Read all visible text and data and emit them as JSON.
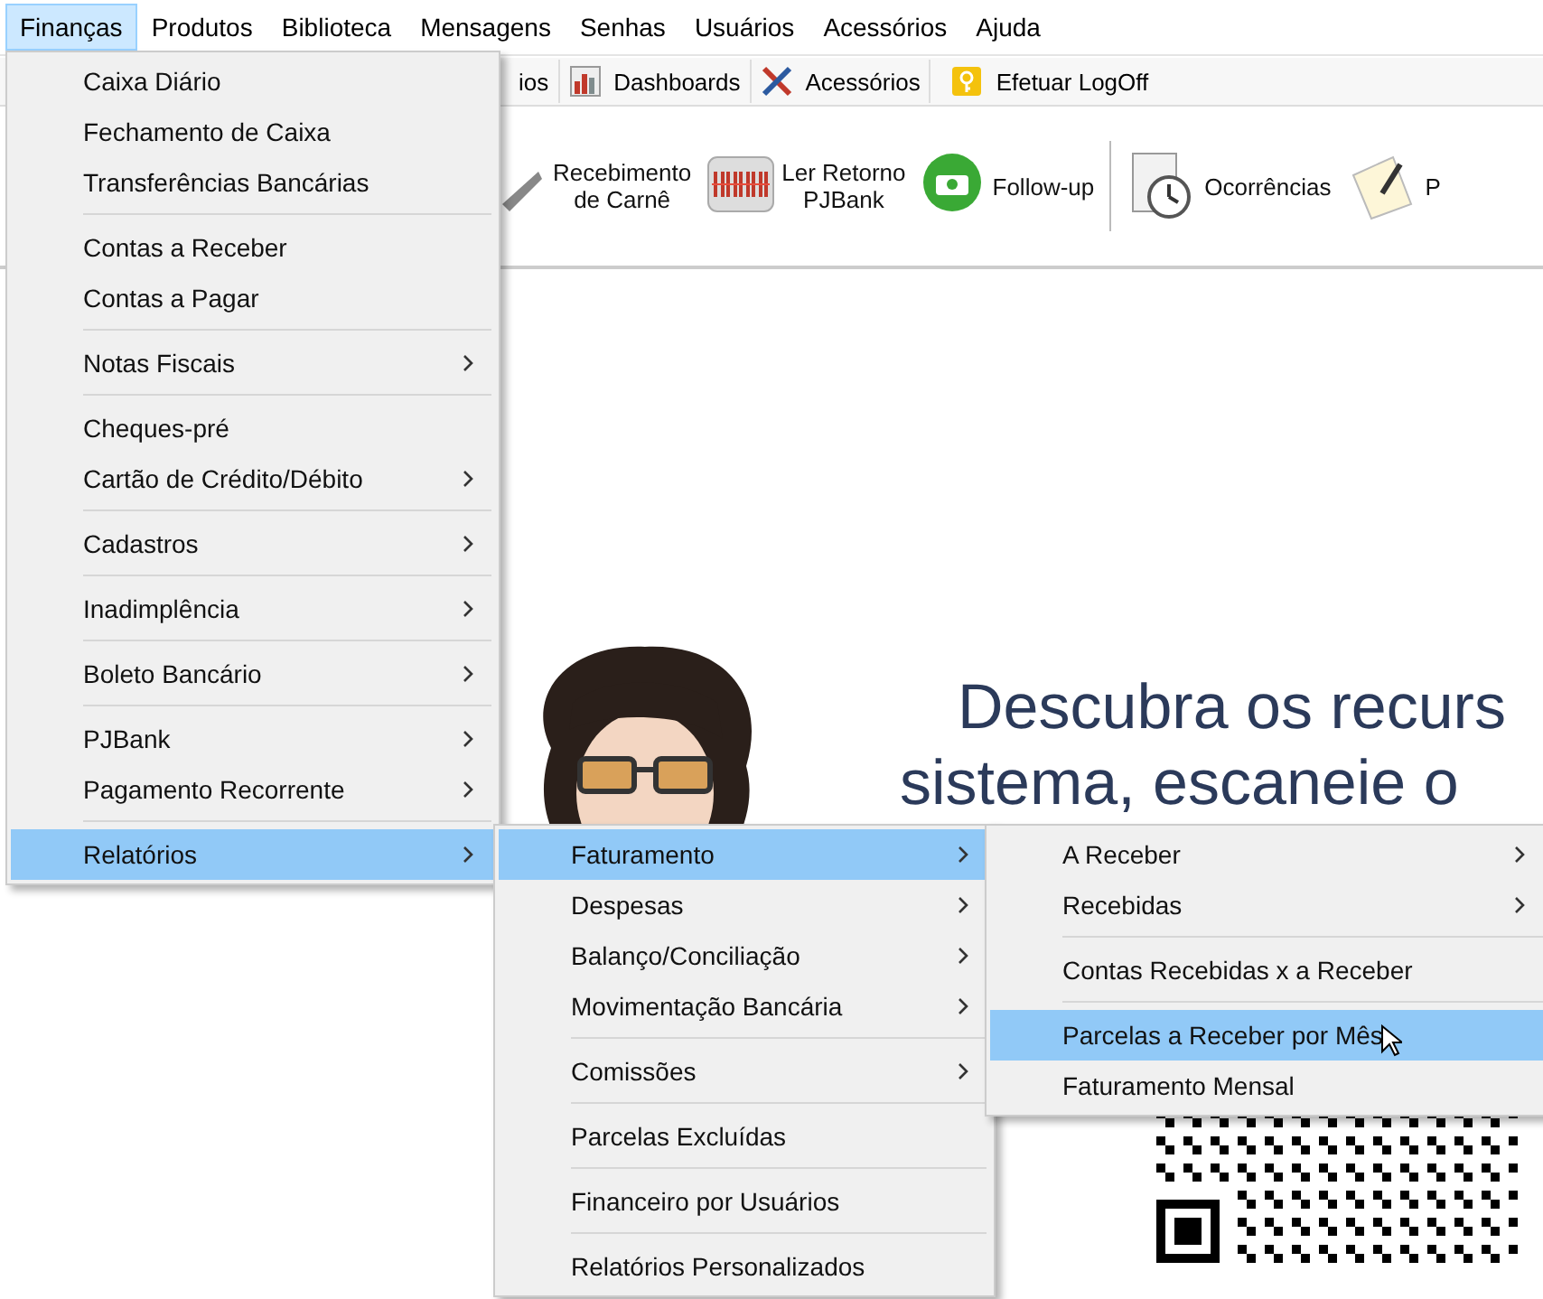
{
  "menubar": [
    {
      "label": "Finanças",
      "selected": true
    },
    {
      "label": "Produtos",
      "selected": false
    },
    {
      "label": "Biblioteca",
      "selected": false
    },
    {
      "label": "Mensagens",
      "selected": false
    },
    {
      "label": "Senhas",
      "selected": false
    },
    {
      "label": "Usuários",
      "selected": false
    },
    {
      "label": "Acessórios",
      "selected": false
    },
    {
      "label": "Ajuda",
      "selected": false
    }
  ],
  "tab_strip": [
    {
      "label": "ios"
    },
    {
      "label": "Dashboards"
    },
    {
      "label": "Acessórios"
    },
    {
      "label": "Efetuar LogOff"
    }
  ],
  "toolbar": [
    {
      "label": "Recebimento\nde Carnê"
    },
    {
      "label": "Ler Retorno\nPJBank"
    },
    {
      "label": "Follow-up"
    },
    {
      "label": "Ocorrências"
    },
    {
      "label": "P"
    }
  ],
  "headline": {
    "lines": [
      "Descubra os recurs",
      "sistema, escaneie o"
    ]
  },
  "menus": [
    {
      "sections": [
        [
          {
            "label": "Caixa Diário",
            "has_submenu": false,
            "selected": false
          },
          {
            "label": "Fechamento de Caixa",
            "has_submenu": false,
            "selected": false
          },
          {
            "label": "Transferências Bancárias",
            "has_submenu": false,
            "selected": false
          }
        ],
        [
          {
            "label": "Contas a Receber",
            "has_submenu": false,
            "selected": false
          },
          {
            "label": "Contas a Pagar",
            "has_submenu": false,
            "selected": false
          }
        ],
        [
          {
            "label": "Notas Fiscais",
            "has_submenu": true,
            "selected": false
          }
        ],
        [
          {
            "label": "Cheques-pré",
            "has_submenu": false,
            "selected": false
          },
          {
            "label": "Cartão de Crédito/Débito",
            "has_submenu": true,
            "selected": false
          }
        ],
        [
          {
            "label": "Cadastros",
            "has_submenu": true,
            "selected": false
          }
        ],
        [
          {
            "label": "Inadimplência",
            "has_submenu": true,
            "selected": false
          }
        ],
        [
          {
            "label": "Boleto Bancário",
            "has_submenu": true,
            "selected": false
          }
        ],
        [
          {
            "label": "PJBank",
            "has_submenu": true,
            "selected": false
          },
          {
            "label": "Pagamento Recorrente",
            "has_submenu": true,
            "selected": false
          }
        ],
        [
          {
            "label": "Relatórios",
            "has_submenu": true,
            "selected": true
          }
        ]
      ]
    },
    {
      "sections": [
        [
          {
            "label": "Faturamento",
            "has_submenu": true,
            "selected": true
          },
          {
            "label": "Despesas",
            "has_submenu": true,
            "selected": false
          },
          {
            "label": "Balanço/Conciliação",
            "has_submenu": true,
            "selected": false
          },
          {
            "label": "Movimentação Bancária",
            "has_submenu": true,
            "selected": false
          }
        ],
        [
          {
            "label": "Comissões",
            "has_submenu": true,
            "selected": false
          }
        ],
        [
          {
            "label": "Parcelas Excluídas",
            "has_submenu": false,
            "selected": false
          }
        ],
        [
          {
            "label": "Financeiro por Usuários",
            "has_submenu": false,
            "selected": false
          }
        ],
        [
          {
            "label": "Relatórios Personalizados",
            "has_submenu": false,
            "selected": false
          }
        ]
      ]
    },
    {
      "sections": [
        [
          {
            "label": "A Receber",
            "has_submenu": true,
            "selected": false
          },
          {
            "label": "Recebidas",
            "has_submenu": true,
            "selected": false
          }
        ],
        [
          {
            "label": "Contas Recebidas x a Receber",
            "has_submenu": false,
            "selected": false
          }
        ],
        [
          {
            "label": "Parcelas a Receber por Mês",
            "has_submenu": false,
            "selected": true
          },
          {
            "label": "Faturamento Mensal",
            "has_submenu": false,
            "selected": false
          }
        ]
      ]
    }
  ]
}
